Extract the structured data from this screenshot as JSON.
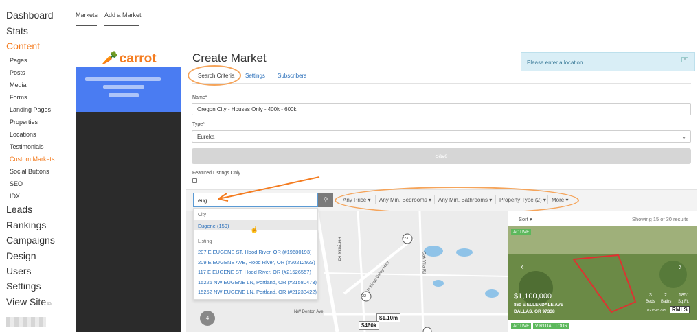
{
  "nav": {
    "dashboard": "Dashboard",
    "stats": "Stats",
    "content": "Content",
    "content_items": [
      "Pages",
      "Posts",
      "Media",
      "Forms",
      "Landing Pages",
      "Properties",
      "Locations",
      "Testimonials",
      "Custom Markets",
      "Social Buttons",
      "SEO",
      "IDX"
    ],
    "active_item": "Custom Markets",
    "leads": "Leads",
    "rankings": "Rankings",
    "campaigns": "Campaigns",
    "design": "Design",
    "users": "Users",
    "settings": "Settings",
    "view_site": "View Site",
    "external_icon": "external-link-icon"
  },
  "top_tabs": [
    "Markets",
    "Add a Market"
  ],
  "preview": {
    "logo_text": "carrot",
    "logo_icon": "carrot-icon"
  },
  "page": {
    "title": "Create Market",
    "tabs": [
      "Search Criteria",
      "Settings",
      "Subscribers"
    ],
    "selected_tab": "Search Criteria"
  },
  "alert": {
    "text": "Please enter a location.",
    "close_icon": "close-icon"
  },
  "form": {
    "name_label": "Name*",
    "name_value": "Oregon City - Houses Only - 400k - 600k",
    "type_label": "Type*",
    "type_value": "Eureka",
    "save_label": "Save",
    "featured_label": "Featured Listings Only",
    "featured_checked": false
  },
  "search": {
    "value": "eug",
    "button_icon": "search-icon",
    "filters": [
      "Any Price",
      "Any Min. Bedrooms",
      "Any Min. Bathrooms",
      "Property Type (2)",
      "More"
    ]
  },
  "autocomplete": {
    "city_header": "City",
    "cities": [
      "Eugene (159)"
    ],
    "listing_header": "Listing",
    "listings": [
      "207 E EUGENE ST, Hood River, OR (#19680193)",
      "209 E EUGENE AVE, Hood River, OR (#20212923)",
      "117 E EUGENE ST, Hood River, OR (#21526557)",
      "15226 NW EUGENE LN, Portland, OR (#21580473)",
      "15252 NW EUGENE LN, Portland, OR (#21233422)"
    ]
  },
  "map": {
    "road_labels": [
      "Perrydale Rd",
      "Oak Villa Rd",
      "N Kings Valley Hwy",
      "NW Denton Ave",
      "223",
      "223",
      "22"
    ],
    "price_tags": [
      "$1.10m",
      "$460k"
    ],
    "cluster_count": "4"
  },
  "results": {
    "sort_label": "Sort",
    "showing": "Showing 15 of 30 results",
    "card": {
      "badge": "ACTIVE",
      "price": "$1,100,000",
      "address_line1": "860 E ELLENDALE AVE",
      "address_line2": "DALLAS, OR 97338",
      "beds": "3",
      "beds_label": "Beds",
      "baths": "2",
      "baths_label": "Baths",
      "sqft": "1851",
      "sqft_label": "Sq.Ft.",
      "mls_number": "#21545795",
      "mls_logo": "RMLS"
    },
    "next_card_badges": [
      "ACTIVE",
      "VIRTUAL TOUR"
    ]
  },
  "colors": {
    "accent": "#f47c20",
    "link": "#2a6fba",
    "preview_blue": "#4a7cf2",
    "alert_bg": "#d9eef6",
    "badge_green": "#5cb85c"
  }
}
